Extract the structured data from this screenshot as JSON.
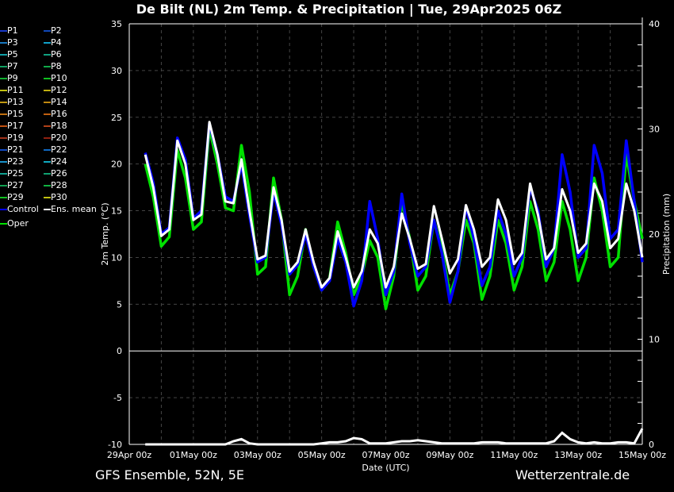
{
  "title": "De Bilt  (NL)  2m Temp. & Precipitation | Tue, 29Apr2025 06Z",
  "footer": {
    "left": "GFS Ensemble, 52N, 5E",
    "right": "Wetterzentrale.de"
  },
  "legend": [
    {
      "label": "P1",
      "color": "#1838c8"
    },
    {
      "label": "P2",
      "color": "#1048b8"
    },
    {
      "label": "P3",
      "color": "#1878c0"
    },
    {
      "label": "P4",
      "color": "#10a0c8"
    },
    {
      "label": "P5",
      "color": "#10a0a8"
    },
    {
      "label": "P6",
      "color": "#10a080"
    },
    {
      "label": "P7",
      "color": "#10a060"
    },
    {
      "label": "P8",
      "color": "#10a848"
    },
    {
      "label": "P9",
      "color": "#10b030"
    },
    {
      "label": "P10",
      "color": "#10c020"
    },
    {
      "label": "P11",
      "color": "#c0c010"
    },
    {
      "label": "P12",
      "color": "#c0b010"
    },
    {
      "label": "P13",
      "color": "#c09810"
    },
    {
      "label": "P14",
      "color": "#c08810"
    },
    {
      "label": "P15",
      "color": "#c07010"
    },
    {
      "label": "P16",
      "color": "#c06010"
    },
    {
      "label": "P17",
      "color": "#c05010"
    },
    {
      "label": "P18",
      "color": "#b04018"
    },
    {
      "label": "P19",
      "color": "#a03018"
    },
    {
      "label": "P20",
      "color": "#902010"
    },
    {
      "label": "P21",
      "color": "#1048c0"
    },
    {
      "label": "P22",
      "color": "#1068c0"
    },
    {
      "label": "P23",
      "color": "#1890c8"
    },
    {
      "label": "P24",
      "color": "#10a8c0"
    },
    {
      "label": "P25",
      "color": "#10a090"
    },
    {
      "label": "P26",
      "color": "#10a070"
    },
    {
      "label": "P27",
      "color": "#10a050"
    },
    {
      "label": "P28",
      "color": "#10b040"
    },
    {
      "label": "P29",
      "color": "#10c020"
    },
    {
      "label": "P30",
      "color": "#c0c010"
    },
    {
      "label": "Control",
      "color": "#0000ff"
    },
    {
      "label": "Ens. mean",
      "color": "#ffffff"
    },
    {
      "label": "Oper",
      "color": "#00e000"
    }
  ],
  "chart_data": {
    "type": "line",
    "title": "De Bilt  (NL)  2m Temp. & Precipitation | Tue, 29Apr2025 06Z",
    "xlabel": "Date (UTC)",
    "ylabel": "2m Temp. (°C)",
    "y2label": "Precipitation (mm)",
    "x_ticks": [
      "29Apr 00z",
      "01May 00z",
      "03May 00z",
      "05May 00z",
      "07May 00z",
      "09May 00z",
      "11May 00z",
      "13May 00z",
      "15May 00z"
    ],
    "x_range": [
      "2025-04-29T00Z",
      "2025-05-15T00Z"
    ],
    "x_start": "2025-04-29T12Z",
    "x_step_hours": 6,
    "ylim": [
      -10,
      35
    ],
    "y_ticks": [
      "35",
      "30",
      "25",
      "20",
      "15",
      "10",
      "5",
      "0",
      "-5",
      "-10"
    ],
    "y2lim": [
      0,
      40
    ],
    "y2_ticks": [
      "40",
      "30",
      "20",
      "10",
      "0"
    ],
    "grid": true,
    "legend_placement": "left",
    "background": "#000000",
    "series": [
      {
        "name": "Ens. mean",
        "color": "#ffffff",
        "values": [
          21,
          17.5,
          12.3,
          13,
          22.5,
          20,
          14,
          14.6,
          24.5,
          21,
          16,
          15.8,
          20.5,
          15,
          9.8,
          10.2,
          17.5,
          14,
          8.5,
          9.5,
          13,
          9.5,
          6.8,
          7.8,
          12.8,
          10,
          6.8,
          8.5,
          13,
          11.5,
          6.8,
          9,
          14.7,
          12,
          8.8,
          9.3,
          15.5,
          12,
          8.3,
          9.8,
          15.6,
          13,
          9,
          10,
          16.2,
          14,
          9.3,
          10.5,
          17.9,
          14.5,
          9.8,
          11,
          17.3,
          15,
          10.5,
          11.5,
          17.9,
          16,
          11,
          12,
          17.9,
          15,
          10
        ]
      },
      {
        "name": "Control",
        "color": "#0000ff",
        "values": [
          21.2,
          18,
          12.5,
          13.2,
          22.8,
          20.5,
          14.2,
          15,
          24.3,
          21,
          16.5,
          16,
          20,
          14.5,
          9.5,
          10,
          17,
          13.5,
          8.2,
          9.2,
          12.5,
          9,
          6.5,
          7.5,
          12,
          9.5,
          4.8,
          7.5,
          16,
          12,
          6,
          8.5,
          16.8,
          11.5,
          8,
          9,
          14,
          10.5,
          5.2,
          8.5,
          15.5,
          12,
          7,
          9,
          15,
          12.5,
          8,
          10,
          17.5,
          15,
          9,
          11,
          21,
          17,
          10,
          11,
          22,
          19,
          12,
          13,
          22.5,
          16,
          9.5
        ]
      },
      {
        "name": "Oper",
        "color": "#00e000",
        "values": [
          20,
          16.5,
          11.2,
          12.2,
          21.5,
          18.5,
          13,
          13.8,
          23.8,
          20,
          15.3,
          15,
          22,
          17,
          8.2,
          9,
          18.5,
          14,
          6,
          8,
          13,
          9,
          6.5,
          7.8,
          13.8,
          10.5,
          6,
          8,
          11.8,
          10,
          4.5,
          8,
          16,
          12,
          6.5,
          8,
          14,
          11,
          6,
          8.5,
          14,
          11.5,
          5.5,
          8,
          14,
          11.5,
          6.5,
          9,
          16,
          13,
          7.5,
          9.5,
          16,
          13,
          7.5,
          10,
          18.5,
          15,
          9,
          10,
          21,
          16,
          12
        ]
      }
    ],
    "precip_series": [
      {
        "name": "Ens. mean",
        "color": "#ffffff",
        "values": [
          0,
          0,
          0,
          0,
          0,
          0,
          0,
          0,
          0,
          0,
          0,
          0.3,
          0.5,
          0.1,
          0,
          0,
          0,
          0,
          0,
          0,
          0,
          0,
          0.1,
          0.2,
          0.2,
          0.3,
          0.6,
          0.5,
          0.1,
          0.1,
          0.1,
          0.2,
          0.3,
          0.3,
          0.4,
          0.3,
          0.2,
          0.1,
          0.1,
          0.1,
          0.1,
          0.1,
          0.2,
          0.2,
          0.2,
          0.1,
          0.1,
          0.1,
          0.1,
          0.1,
          0.1,
          0.3,
          1.1,
          0.5,
          0.2,
          0.1,
          0.2,
          0.1,
          0.1,
          0.2,
          0.2,
          0.1,
          1.5
        ]
      }
    ]
  }
}
